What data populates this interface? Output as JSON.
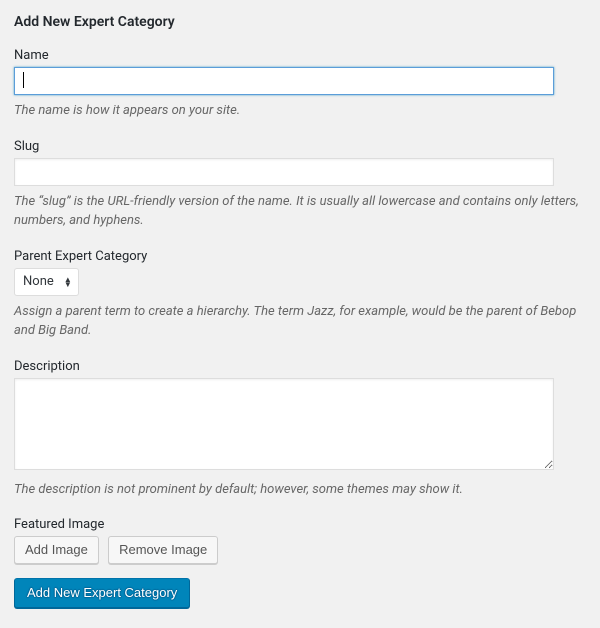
{
  "form": {
    "title": "Add New Expert Category",
    "name": {
      "label": "Name",
      "value": "",
      "description": "The name is how it appears on your site."
    },
    "slug": {
      "label": "Slug",
      "value": "",
      "description": "The “slug” is the URL-friendly version of the name. It is usually all lowercase and contains only letters, numbers, and hyphens."
    },
    "parent": {
      "label": "Parent Expert Category",
      "selected": "None",
      "description": "Assign a parent term to create a hierarchy. The term Jazz, for example, would be the parent of Bebop and Big Band."
    },
    "description_field": {
      "label": "Description",
      "value": "",
      "description": "The description is not prominent by default; however, some themes may show it."
    },
    "featured_image": {
      "label": "Featured Image",
      "add_button": "Add Image",
      "remove_button": "Remove Image"
    },
    "submit_label": "Add New Expert Category"
  }
}
